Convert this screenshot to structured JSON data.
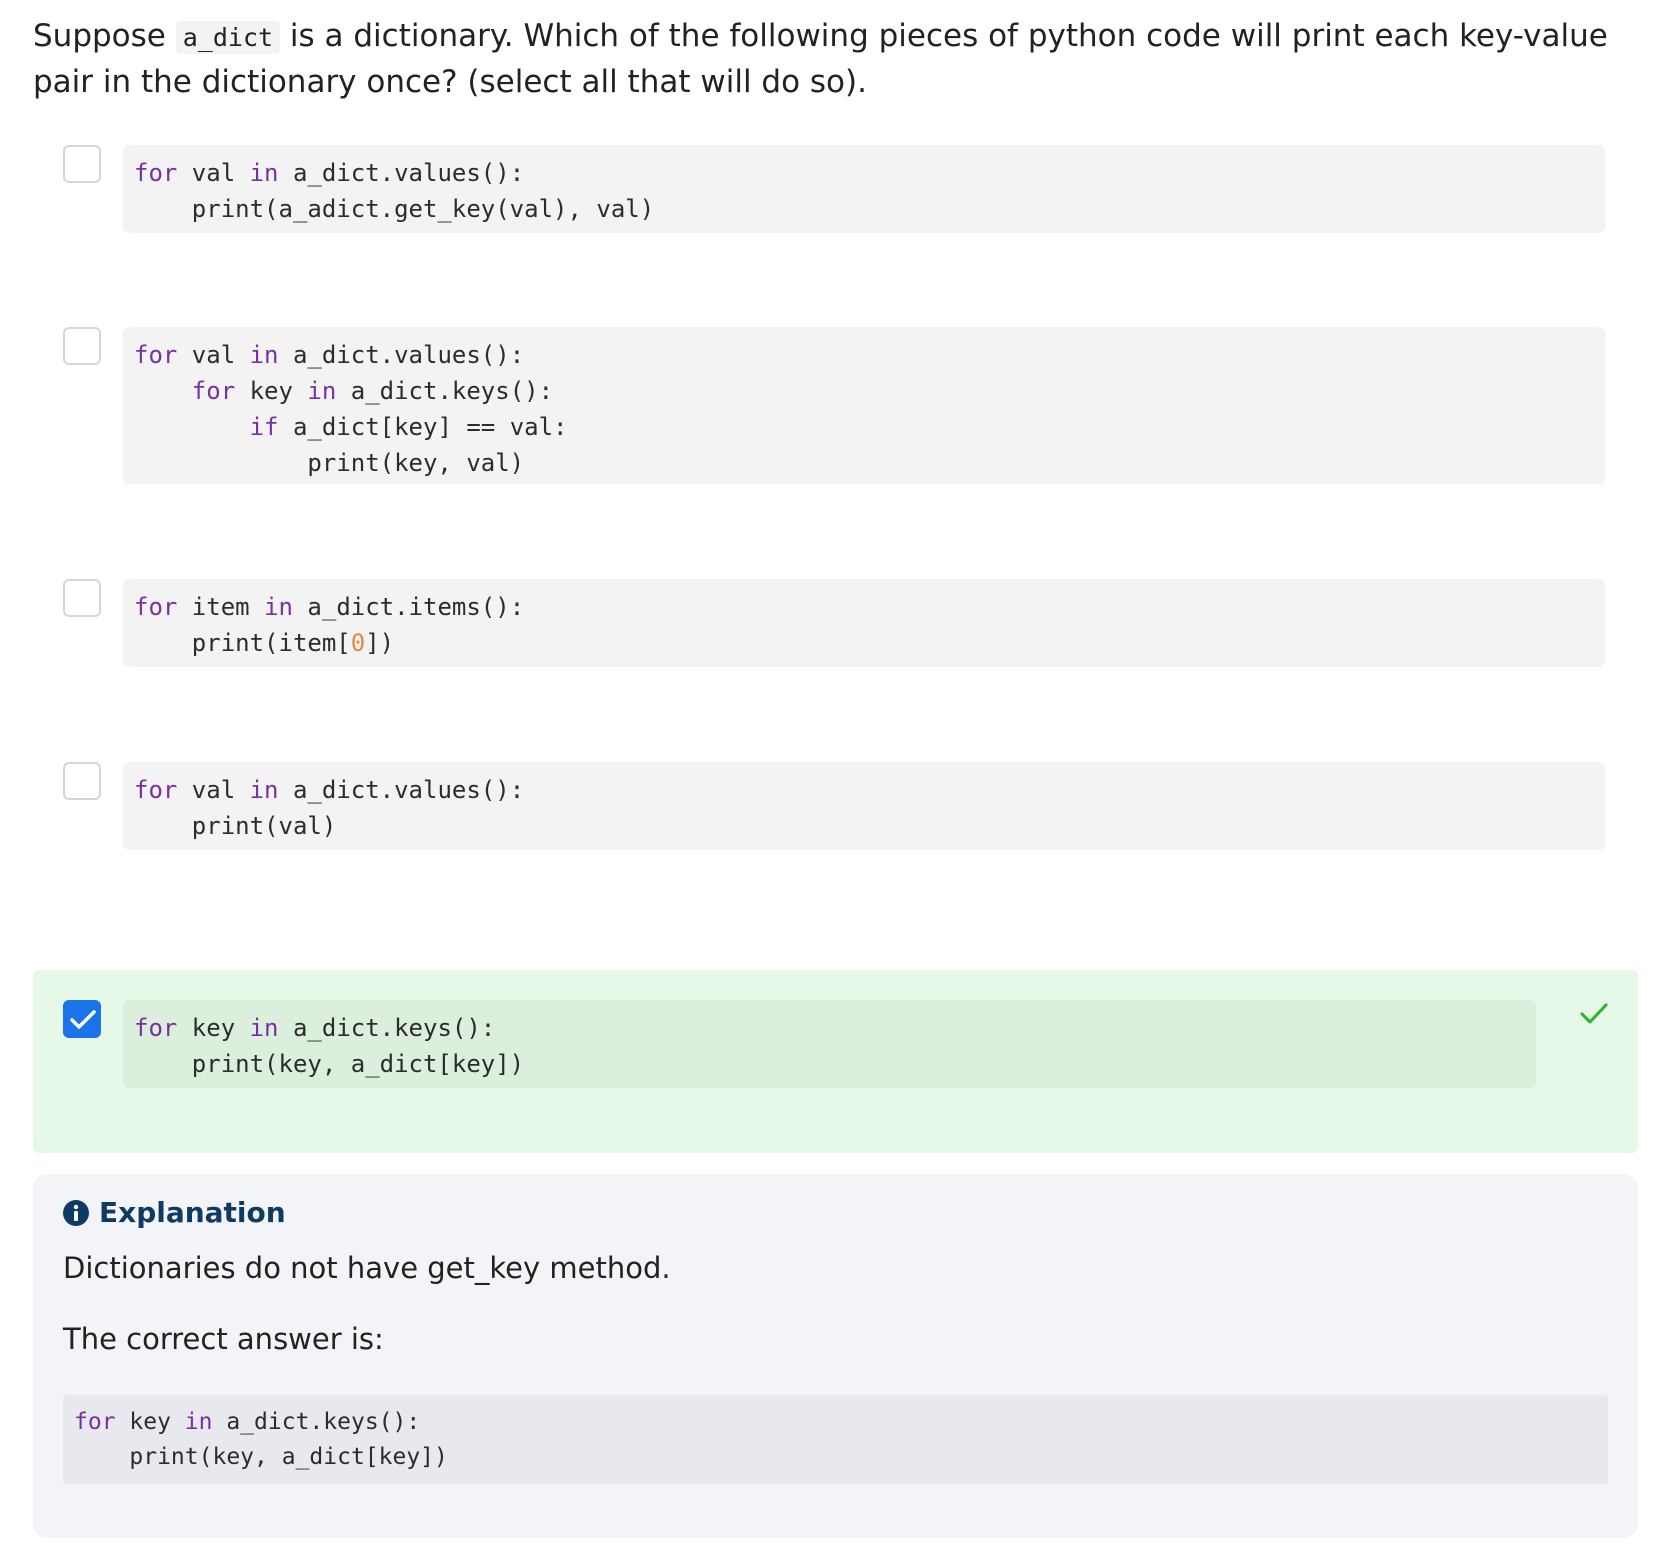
{
  "question": {
    "prefix": "Suppose ",
    "code": "a_dict",
    "suffix": " is a dictionary. Which of the following pieces of python code will print each key-value pair in the dictionary once? (select all that will do so)."
  },
  "options": [
    {
      "checked": false,
      "lines": [
        [
          "for",
          " val ",
          "in",
          " a_dict.values():"
        ],
        [
          "    print(a_adict.get_key(val), val)"
        ]
      ]
    },
    {
      "checked": false,
      "lines": [
        [
          "for",
          " val ",
          "in",
          " a_dict.values():"
        ],
        [
          "    ",
          "for",
          " key ",
          "in",
          " a_dict.keys():"
        ],
        [
          "        ",
          "if",
          " a_dict[key] == val:"
        ],
        [
          "            print(key, val)"
        ]
      ]
    },
    {
      "checked": false,
      "lines": [
        [
          "for",
          " item ",
          "in",
          " a_dict.items():"
        ],
        [
          "    print(item[",
          "0",
          "])"
        ]
      ]
    },
    {
      "checked": false,
      "lines": [
        [
          "for",
          " val ",
          "in",
          " a_dict.values():"
        ],
        [
          "    print(val)"
        ]
      ]
    },
    {
      "checked": true,
      "correct": true,
      "lines": [
        [
          "for",
          " key ",
          "in",
          " a_dict.keys():"
        ],
        [
          "    print(key, a_dict[key])"
        ]
      ]
    }
  ],
  "explanation": {
    "title": "Explanation",
    "text": "Dictionaries do not have get_key method.",
    "answer_intro": "The correct answer is:",
    "answer_lines": [
      [
        "for",
        " key ",
        "in",
        " a_dict.keys():"
      ],
      [
        "    print(key, a_dict[key])"
      ]
    ]
  },
  "colors": {
    "keyword": "#7a2fa3",
    "number": "#e5883d",
    "checkbox_checked": "#1a73e8",
    "correct_tick": "#2bb32b"
  }
}
